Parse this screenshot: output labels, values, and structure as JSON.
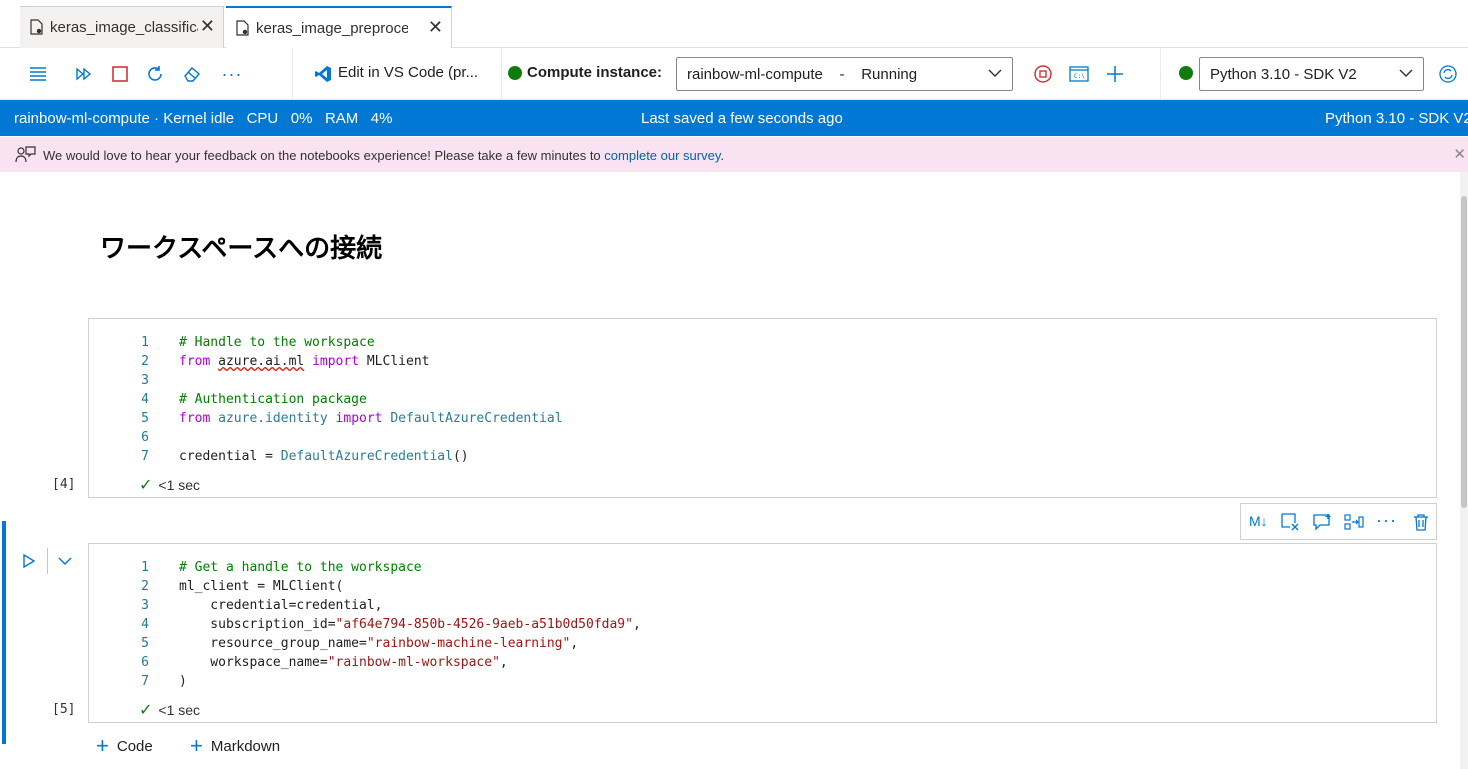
{
  "tabs": [
    {
      "label": "keras_image_classification"
    },
    {
      "label": "keras_image_preprocessing"
    }
  ],
  "toolbar": {
    "vscode_label": "Edit in VS Code (pr...",
    "compute_label": "Compute instance:",
    "compute_value": "rainbow-ml-compute    -    Running",
    "kernel_value": "Python 3.10 - SDK V2"
  },
  "status": {
    "left": "rainbow-ml-compute · Kernel idle   CPU   0%   RAM   4%",
    "center": "Last saved a few seconds ago",
    "right": "Python 3.10 - SDK V2"
  },
  "feedback": {
    "text": "We would love to hear your feedback on the notebooks experience! Please take a few minutes to ",
    "link": "complete our survey",
    "end": "."
  },
  "heading": "ワークスペースへの接続",
  "cells": [
    {
      "exec": "[4]",
      "time": "<1 sec",
      "line_numbers": [
        "1",
        "2",
        "3",
        "4",
        "5",
        "6",
        "7"
      ]
    },
    {
      "exec": "[5]",
      "time": "<1 sec",
      "line_numbers": [
        "1",
        "2",
        "3",
        "4",
        "5",
        "6",
        "7"
      ]
    }
  ],
  "code1": {
    "l1": "# Handle to the workspace",
    "l2_kw": "from",
    "l2_mod": "azure.ai.ml",
    "l2_kw2": "import",
    "l2_name": "MLClient",
    "l4": "# Authentication package",
    "l5_kw": "from",
    "l5_mod": "azure.identity",
    "l5_kw2": "import",
    "l5_name": "DefaultAzureCredential",
    "l7_a": "credential = ",
    "l7_fn": "DefaultAzureCredential",
    "l7_b": "()"
  },
  "code2": {
    "l1": "# Get a handle to the workspace",
    "l2": "ml_client = MLClient(",
    "l3": "    credential=credential,",
    "l4_a": "    subscription_id=",
    "l4_s": "\"af64e794-850b-4526-9aeb-a51b0d50fda9\"",
    "l4_b": ",",
    "l5_a": "    resource_group_name=",
    "l5_s": "\"rainbow-machine-learning\"",
    "l5_b": ",",
    "l6_a": "    workspace_name=",
    "l6_s": "\"rainbow-ml-workspace\"",
    "l6_b": ",",
    "l7": ")"
  },
  "add": {
    "code": "Code",
    "markdown": "Markdown"
  },
  "celltools": {
    "md": "M↓"
  }
}
